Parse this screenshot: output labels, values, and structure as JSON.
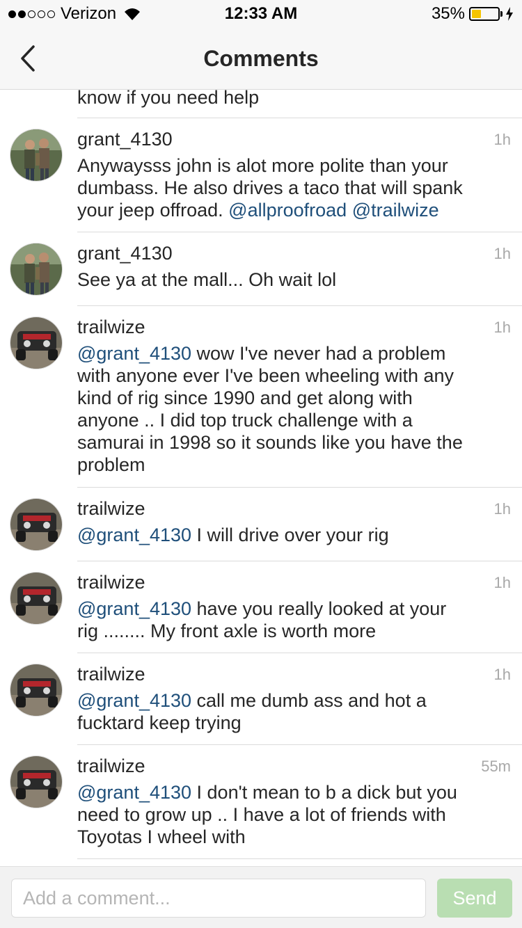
{
  "status_bar": {
    "carrier": "Verizon",
    "signal_bars_filled": 2,
    "signal_bars_total": 5,
    "time": "12:33 AM",
    "battery_percent_label": "35%",
    "battery_level": 0.35,
    "battery_color": "#f5c400"
  },
  "nav": {
    "title": "Comments",
    "back_icon": "chevron-left-icon"
  },
  "top_fragment": "know if you need help",
  "comments": [
    {
      "username": "grant_4130",
      "time": "1h",
      "avatar": "two-hunters-photo",
      "lines": [
        [
          {
            "t": "Anywaysss john is alot more polite than your"
          }
        ],
        [
          {
            "t": "dumbass. He also drives a taco that will spank"
          }
        ],
        [
          {
            "t": "your jeep offroad. "
          },
          {
            "t": "@allproofroad",
            "m": true
          },
          {
            "t": " "
          },
          {
            "t": "@trailwize",
            "m": true
          }
        ]
      ]
    },
    {
      "username": "grant_4130",
      "time": "1h",
      "avatar": "two-hunters-photo",
      "lines": [
        [
          {
            "t": "See ya at the mall... Oh wait lol"
          }
        ]
      ]
    },
    {
      "username": "trailwize",
      "time": "1h",
      "avatar": "red-jeep-photo",
      "lines": [
        [
          {
            "t": "@grant_4130",
            "m": true
          },
          {
            "t": " wow I've never had a problem"
          }
        ],
        [
          {
            "t": "with anyone ever I've been wheeling with any"
          }
        ],
        [
          {
            "t": "kind of rig since 1990 and get along with"
          }
        ],
        [
          {
            "t": "anyone .. I did top truck challenge with a"
          }
        ],
        [
          {
            "t": "samurai in 1998 so it sounds like you have the"
          }
        ],
        [
          {
            "t": "problem"
          }
        ]
      ]
    },
    {
      "username": "trailwize",
      "time": "1h",
      "avatar": "red-jeep-photo",
      "lines": [
        [
          {
            "t": "@grant_4130",
            "m": true
          },
          {
            "t": " I will drive over your rig"
          }
        ]
      ]
    },
    {
      "username": "trailwize",
      "time": "1h",
      "avatar": "red-jeep-photo",
      "lines": [
        [
          {
            "t": "@grant_4130",
            "m": true
          },
          {
            "t": " have you really looked at your"
          }
        ],
        [
          {
            "t": "rig ........ My front axle is worth more"
          }
        ]
      ]
    },
    {
      "username": "trailwize",
      "time": "1h",
      "avatar": "red-jeep-photo",
      "lines": [
        [
          {
            "t": "@grant_4130",
            "m": true
          },
          {
            "t": " call me dumb ass and hot a"
          }
        ],
        [
          {
            "t": "fucktard keep trying"
          }
        ]
      ]
    },
    {
      "username": "trailwize",
      "time": "55m",
      "avatar": "red-jeep-photo",
      "lines": [
        [
          {
            "t": "@grant_4130",
            "m": true
          },
          {
            "t": " I don't mean to b a dick but you"
          }
        ],
        [
          {
            "t": "need to grow up .. I have a lot of friends with"
          }
        ],
        [
          {
            "t": "Toyotas I wheel with"
          }
        ]
      ]
    }
  ],
  "composer": {
    "placeholder": "Add a comment...",
    "send_label": "Send",
    "send_color": "#b9deb2"
  },
  "colors": {
    "mention": "#1f4f7a",
    "text": "#262626",
    "timestamp": "#a8a8a8"
  }
}
